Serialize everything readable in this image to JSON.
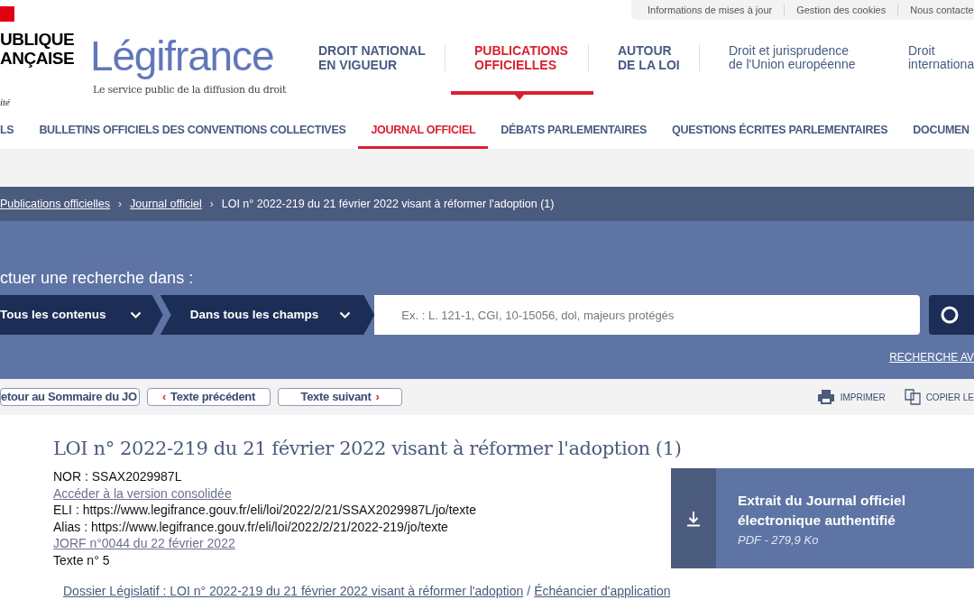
{
  "utility_links": [
    {
      "label": "Informations de mises à jour"
    },
    {
      "label": "Gestion des cookies"
    },
    {
      "label": "Nous contacte"
    }
  ],
  "logo": {
    "lines": [
      "UBLIQUE",
      "ANÇAISE"
    ],
    "motto": "ité"
  },
  "brand": {
    "name": "Légifrance",
    "tagline": "Le service public de la diffusion du droit"
  },
  "main_nav": [
    {
      "lines": [
        "DROIT NATIONAL",
        "EN VIGUEUR"
      ],
      "kind": "caps",
      "selected": false
    },
    {
      "lines": [
        "PUBLICATIONS",
        "OFFICIELLES"
      ],
      "kind": "caps",
      "selected": true
    },
    {
      "lines": [
        "AUTOUR",
        "DE LA LOI"
      ],
      "kind": "caps",
      "selected": false
    },
    {
      "lines": [
        "Droit et jurisprudence",
        "de l'Union européenne"
      ],
      "kind": "plain",
      "selected": false
    },
    {
      "lines": [
        "Droit",
        "internationa"
      ],
      "kind": "plain",
      "selected": false
    }
  ],
  "sub_nav": [
    {
      "label": "LS",
      "selected": false
    },
    {
      "label": "BULLETINS OFFICIELS DES CONVENTIONS COLLECTIVES",
      "selected": false
    },
    {
      "label": "JOURNAL OFFICIEL",
      "selected": true
    },
    {
      "label": "DÉBATS PARLEMENTAIRES",
      "selected": false
    },
    {
      "label": "QUESTIONS ÉCRITES PARLEMENTAIRES",
      "selected": false
    },
    {
      "label": "DOCUMEN",
      "selected": false
    }
  ],
  "breadcrumb_separator": "›",
  "breadcrumb": [
    {
      "label": "Publications officielles",
      "kind": "link"
    },
    {
      "label": "Journal officiel",
      "kind": "link"
    },
    {
      "label": "LOI n° 2022-219 du 21 février 2022 visant à réformer l'adoption (1)",
      "kind": "current"
    }
  ],
  "search": {
    "heading": "ctuer une recherche dans :",
    "scopes": [
      "Tous les contenus",
      "Dans tous les champs"
    ],
    "placeholder": "Ex. : L. 121-1, CGI, 10-15056, dol, majeurs protégés",
    "advanced_link": "RECHERCHE AV"
  },
  "toolbar": {
    "nav_buttons": [
      {
        "label": "etour au Sommaire du JO"
      },
      {
        "label": "Texte précédent",
        "prefix": "‹"
      },
      {
        "label": "Texte suivant",
        "suffix": "›"
      }
    ],
    "actions": [
      {
        "label": "IMPRIMER",
        "kind": "print"
      },
      {
        "label": "COPIER LE",
        "kind": "copy"
      }
    ]
  },
  "document": {
    "title": "LOI n° 2022-219 du 21 février 2022 visant à réformer l'adoption (1)",
    "meta": [
      {
        "kind": "text",
        "text": "NOR : SSAX2029987L"
      },
      {
        "kind": "link",
        "text": "Accéder à la version consolidée"
      },
      {
        "kind": "text",
        "text": "ELI : https://www.legifrance.gouv.fr/eli/loi/2022/2/21/SSAX2029987L/jo/texte"
      },
      {
        "kind": "text",
        "text": "Alias : https://www.legifrance.gouv.fr/eli/loi/2022/2/21/2022-219/jo/texte"
      },
      {
        "kind": "link",
        "text": "JORF n°0044 du 22 février 2022"
      },
      {
        "kind": "text",
        "text": "Texte n° 5"
      }
    ],
    "related_links": [
      "Dossier Législatif : LOI n° 2022-219 du 21 février 2022 visant à réformer l'adoption",
      "Échéancier d'application"
    ],
    "related_separator": "/"
  },
  "download": {
    "title": "Extrait du Journal officiel électronique authentifié",
    "subtitle": "PDF - 279,9 Ko"
  }
}
